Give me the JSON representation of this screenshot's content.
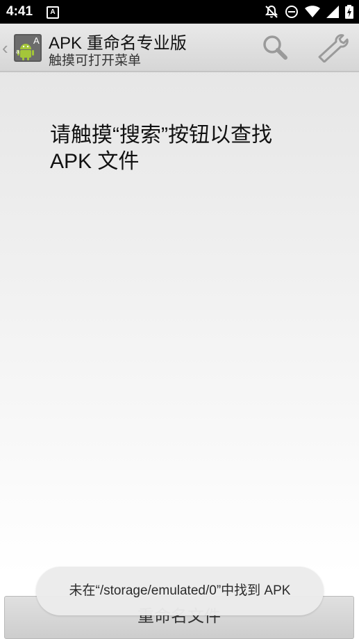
{
  "status_bar": {
    "time": "4:41",
    "notification_glyph": "A",
    "icons": [
      "notifications-off-icon",
      "do-not-disturb-icon",
      "wifi-icon",
      "cell-signal-icon",
      "battery-charging-icon"
    ]
  },
  "action_bar": {
    "title": "APK 重命名专业版",
    "subtitle": "触摸可打开菜单",
    "icons": [
      "back-chevron-icon",
      "android-app-icon",
      "search-icon",
      "wrench-icon"
    ]
  },
  "main": {
    "instruction": "请触摸“搜索”按钮以查找 APK 文件"
  },
  "bottom": {
    "rename_button_label": "重命名文件"
  },
  "toast": {
    "message": "未在“/storage/emulated/0”中找到 APK"
  },
  "colors": {
    "android_green": "#a4c639",
    "statusbar_bg": "#000000",
    "actionbar_bg": "#dedede"
  }
}
